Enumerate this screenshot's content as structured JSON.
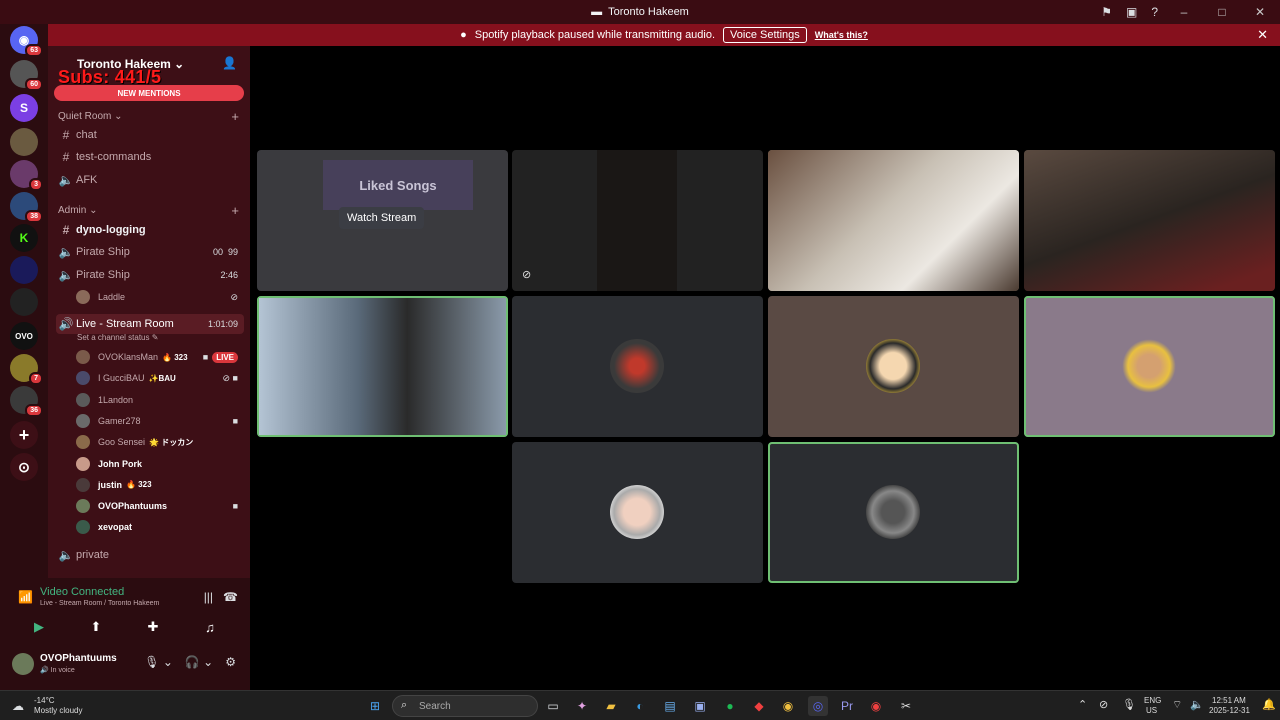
{
  "titlebar": {
    "title": "Toronto Hakeem"
  },
  "notice": {
    "message": "Spotify playback paused while transmitting audio.",
    "voice_settings_label": "Voice Settings",
    "whats_this_label": "What's this?"
  },
  "rail": {
    "servers": [
      {
        "name": "direct-messages",
        "badge": "63",
        "color": "#5865f2",
        "glyph": "◉"
      },
      {
        "name": "server-1",
        "badge": "60",
        "color": "#555",
        "glyph": ""
      },
      {
        "name": "server-2",
        "badge": "",
        "color": "#7b3fe4",
        "glyph": "S"
      },
      {
        "name": "server-3",
        "badge": "",
        "color": "#6a5a40",
        "glyph": ""
      },
      {
        "name": "server-4",
        "badge": "3",
        "color": "#6a3a6a",
        "glyph": ""
      },
      {
        "name": "server-5",
        "badge": "38",
        "color": "#2c4a7a",
        "glyph": ""
      },
      {
        "name": "server-kick",
        "badge": "",
        "color": "#111",
        "glyph": "K"
      },
      {
        "name": "server-6",
        "badge": "",
        "color": "#1a1a5a",
        "glyph": ""
      },
      {
        "name": "server-7",
        "badge": "",
        "color": "#222",
        "glyph": ""
      },
      {
        "name": "server-ovo",
        "badge": "",
        "color": "#111",
        "glyph": "OVO"
      },
      {
        "name": "server-8",
        "badge": "7",
        "color": "#8a7a2a",
        "glyph": ""
      },
      {
        "name": "server-9",
        "badge": "36",
        "color": "#3a3a3a",
        "glyph": ""
      }
    ],
    "add_label": "+",
    "discover_label": "⊙"
  },
  "sidebar": {
    "guild_name": "Toronto Hakeem",
    "subs_overlay": "Subs: 441/5",
    "new_mentions": "NEW MENTIONS",
    "categories": {
      "quiet_room": "Quiet Room",
      "admin": "Admin"
    },
    "channels": {
      "chat": "chat",
      "test_commands": "test-commands",
      "afk": "AFK",
      "dyno_logging": "dyno-logging",
      "pirate_ship_1": "Pirate Ship",
      "pirate_ship_1_meta_a": "00",
      "pirate_ship_1_meta_b": "99",
      "pirate_ship_2": "Pirate Ship",
      "pirate_ship_2_meta": "2:46",
      "laddle": "Laddle",
      "live_stream_room": "Live - Stream Room",
      "live_stream_time": "1:01:09",
      "set_status": "Set a channel status",
      "private": "private"
    },
    "members": [
      {
        "name": "OVOKlansMan",
        "extra": "🔥 323",
        "bold": false,
        "live": "LIVE",
        "color": "#7a5a4a"
      },
      {
        "name": "I GucciBAU",
        "extra": "✨BAU",
        "bold": false,
        "live": "",
        "color": "#4a4a6a"
      },
      {
        "name": "1Landon",
        "extra": "",
        "bold": false,
        "live": "",
        "color": "#5a5a5a"
      },
      {
        "name": "Gamer278",
        "extra": "",
        "bold": false,
        "live": "",
        "color": "#6a6a6a"
      },
      {
        "name": "Goo Sensei",
        "extra": "🌟 ドッカン",
        "bold": false,
        "live": "",
        "color": "#8a6a4a"
      },
      {
        "name": "John Pork",
        "extra": "",
        "bold": true,
        "live": "",
        "color": "#c89a8a"
      },
      {
        "name": "justin",
        "extra": "🔥 323",
        "bold": true,
        "live": "",
        "color": "#4a3a3a"
      },
      {
        "name": "OVOPhantuums",
        "extra": "",
        "bold": true,
        "live": "",
        "color": "#6b7a5a"
      },
      {
        "name": "xevopat",
        "extra": "",
        "bold": true,
        "live": "",
        "color": "#3a5a4a"
      }
    ]
  },
  "voice": {
    "status": "Video Connected",
    "sub": "Live - Stream Room / Toronto Hakeem"
  },
  "user": {
    "name": "OVOPhantuums",
    "status": "In voice"
  },
  "stage": {
    "watch_stream_label": "Watch Stream",
    "liked_songs_label": "Liked Songs"
  },
  "taskbar": {
    "weather_temp": "-14°C",
    "weather_desc": "Mostly cloudy",
    "search_placeholder": "Search",
    "lang_1": "ENG",
    "lang_2": "US",
    "time": "12:51 AM",
    "date": "2025-12-31"
  },
  "colors": {
    "accent_red": "#86101d",
    "sidebar_bg": "#3d0f16",
    "speaking_green": "#6fbf73"
  }
}
